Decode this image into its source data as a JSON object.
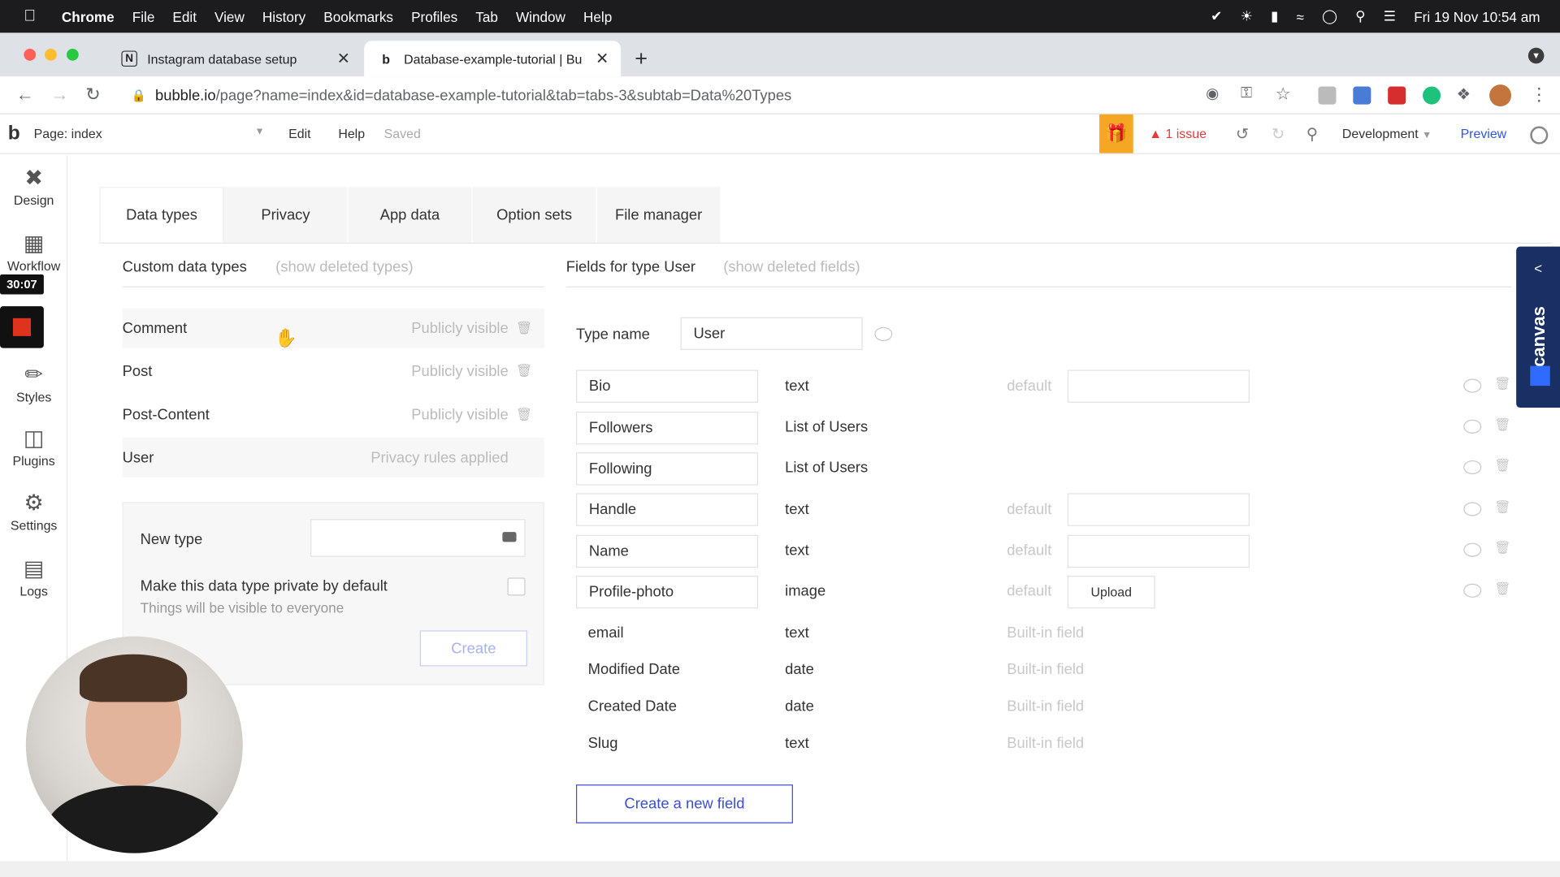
{
  "menubar": {
    "app": "Chrome",
    "items": [
      "File",
      "Edit",
      "View",
      "History",
      "Bookmarks",
      "Profiles",
      "Tab",
      "Window",
      "Help"
    ],
    "clock": "Fri 19 Nov  10:54 am"
  },
  "browser": {
    "tabs": [
      {
        "label": "Instagram database setup",
        "favicon": "N"
      },
      {
        "label": "Database-example-tutorial | Bu",
        "favicon": "b"
      }
    ],
    "url_host": "bubble.io",
    "url_path": "/page?name=index&id=database-example-tutorial&tab=tabs-3&subtab=Data%20Types"
  },
  "editor_header": {
    "page_label": "Page: index",
    "menu": [
      "Edit",
      "Help"
    ],
    "saved": "Saved",
    "issues": "1 issue",
    "environment": "Development",
    "preview": "Preview"
  },
  "left_nav": [
    {
      "label": "Design",
      "icon": "design-icon"
    },
    {
      "label": "Workflow",
      "icon": "workflow-icon"
    },
    {
      "label": "Styles",
      "icon": "styles-icon"
    },
    {
      "label": "Plugins",
      "icon": "plugins-icon"
    },
    {
      "label": "Settings",
      "icon": "settings-icon"
    },
    {
      "label": "Logs",
      "icon": "logs-icon"
    }
  ],
  "recorder": {
    "timer": "30:07"
  },
  "data_tabs": [
    "Data types",
    "Privacy",
    "App data",
    "Option sets",
    "File manager"
  ],
  "custom_types": {
    "title": "Custom data types",
    "show_deleted": "(show deleted types)",
    "rows": [
      {
        "name": "Comment",
        "visibility": "Publicly visible"
      },
      {
        "name": "Post",
        "visibility": "Publicly visible"
      },
      {
        "name": "Post-Content",
        "visibility": "Publicly visible"
      },
      {
        "name": "User",
        "visibility": "Privacy rules applied"
      }
    ]
  },
  "new_type": {
    "label": "New type",
    "value": "",
    "private_label": "Make this data type private by default",
    "private_hint": "Things will be visible to everyone",
    "create": "Create"
  },
  "fields_panel": {
    "title": "Fields for type User",
    "show_deleted": "(show deleted fields)",
    "type_name_label": "Type name",
    "type_name_value": "User",
    "editable_fields": [
      {
        "name": "Bio",
        "type": "text",
        "default_label": "default",
        "default_kind": "input"
      },
      {
        "name": "Followers",
        "type": "List of Users",
        "default_label": "",
        "default_kind": "none"
      },
      {
        "name": "Following",
        "type": "List of Users",
        "default_label": "",
        "default_kind": "none"
      },
      {
        "name": "Handle",
        "type": "text",
        "default_label": "default",
        "default_kind": "input"
      },
      {
        "name": "Name",
        "type": "text",
        "default_label": "default",
        "default_kind": "input"
      },
      {
        "name": "Profile-photo",
        "type": "image",
        "default_label": "default",
        "default_kind": "upload",
        "upload_label": "Upload"
      }
    ],
    "builtin_fields": [
      {
        "name": "email",
        "type": "text",
        "note": "Built-in field"
      },
      {
        "name": "Modified Date",
        "type": "date",
        "note": "Built-in field"
      },
      {
        "name": "Created Date",
        "type": "date",
        "note": "Built-in field"
      },
      {
        "name": "Slug",
        "type": "text",
        "note": "Built-in field"
      }
    ],
    "create_field": "Create a new field"
  },
  "canvas_tab": {
    "label": "canvas"
  }
}
